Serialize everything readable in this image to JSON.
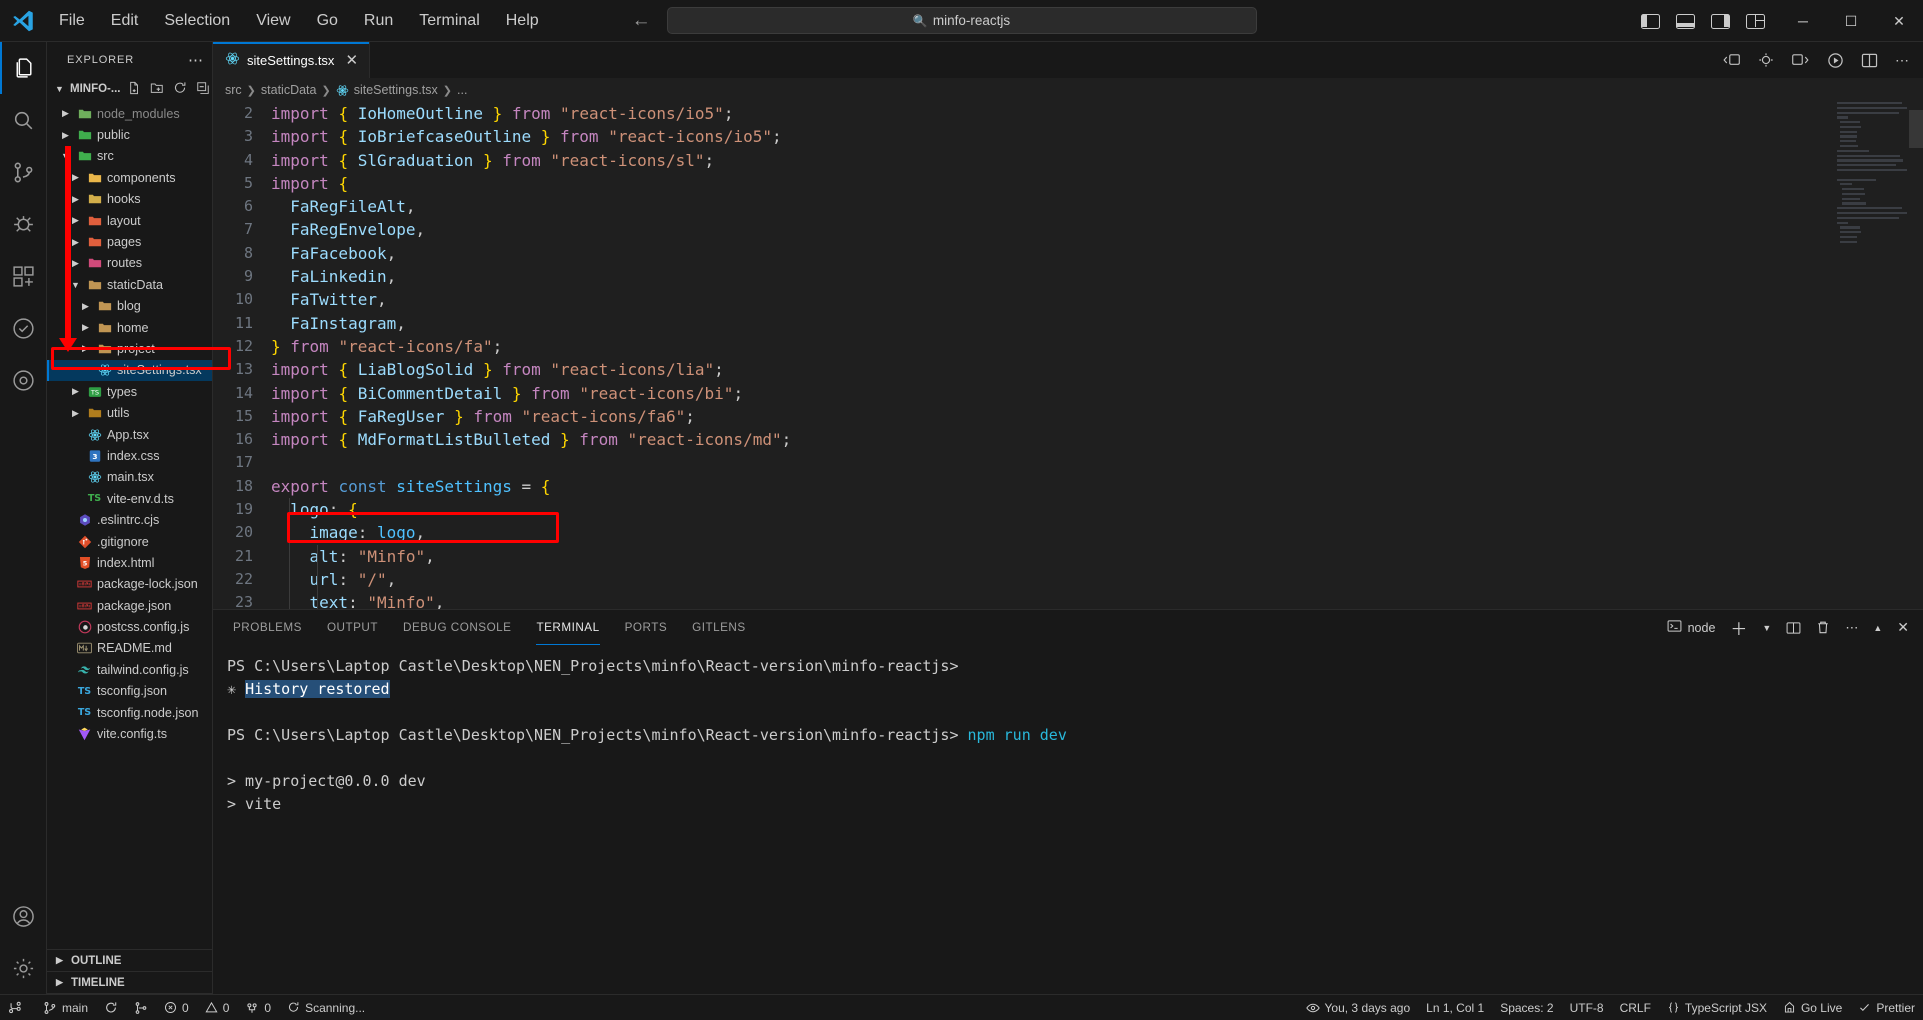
{
  "titlebar": {
    "logo_icon": "vscode-logo-icon",
    "menus": [
      "File",
      "Edit",
      "Selection",
      "View",
      "Go",
      "Run",
      "Terminal",
      "Help"
    ],
    "nav_back_icon": "arrow-left-icon",
    "nav_forward_icon": "arrow-right-icon",
    "search_value": "minfo-reactjs",
    "search_icon": "search-icon",
    "layout_icons": [
      "toggle-primary-sidebar-icon",
      "toggle-panel-icon",
      "toggle-secondary-sidebar-icon",
      "customize-layout-icon"
    ],
    "window_controls": {
      "minimize": "─",
      "maximize": "☐",
      "close": "✕"
    }
  },
  "activitybar": {
    "items": [
      {
        "name": "explorer",
        "icon": "files-icon",
        "active": true
      },
      {
        "name": "search",
        "icon": "search-icon",
        "active": false
      },
      {
        "name": "source-control",
        "icon": "source-control-icon",
        "active": false
      },
      {
        "name": "run-and-debug",
        "icon": "debug-icon",
        "active": false
      },
      {
        "name": "extensions",
        "icon": "extensions-icon",
        "active": false
      },
      {
        "name": "testing",
        "icon": "beaker-icon",
        "active": false
      },
      {
        "name": "gitlens",
        "icon": "gitlens-icon",
        "active": false
      }
    ],
    "bottom": [
      {
        "name": "accounts",
        "icon": "account-icon"
      },
      {
        "name": "settings",
        "icon": "gear-icon"
      }
    ]
  },
  "sidebar": {
    "header_title": "EXPLORER",
    "header_more_icon": "ellipsis-icon",
    "project_name": "MINFO-...",
    "project_actions": [
      "new-file-icon",
      "new-folder-icon",
      "refresh-icon",
      "collapse-all-icon"
    ],
    "tree": [
      {
        "label": "node_modules",
        "depth": 1,
        "type": "folder",
        "expanded": false,
        "icon": "folder-node-modules-icon",
        "dim": true
      },
      {
        "label": "public",
        "depth": 1,
        "type": "folder",
        "expanded": false,
        "icon": "folder-public-icon"
      },
      {
        "label": "src",
        "depth": 1,
        "type": "folder",
        "expanded": true,
        "icon": "folder-src-icon"
      },
      {
        "label": "components",
        "depth": 2,
        "type": "folder",
        "expanded": false,
        "icon": "folder-components-icon"
      },
      {
        "label": "hooks",
        "depth": 2,
        "type": "folder",
        "expanded": false,
        "icon": "folder-hooks-icon"
      },
      {
        "label": "layout",
        "depth": 2,
        "type": "folder",
        "expanded": false,
        "icon": "folder-layout-icon"
      },
      {
        "label": "pages",
        "depth": 2,
        "type": "folder",
        "expanded": false,
        "icon": "folder-pages-icon"
      },
      {
        "label": "routes",
        "depth": 2,
        "type": "folder",
        "expanded": false,
        "icon": "folder-routes-icon"
      },
      {
        "label": "staticData",
        "depth": 2,
        "type": "folder",
        "expanded": true,
        "icon": "folder-icon"
      },
      {
        "label": "blog",
        "depth": 3,
        "type": "folder",
        "expanded": false,
        "icon": "folder-icon"
      },
      {
        "label": "home",
        "depth": 3,
        "type": "folder",
        "expanded": false,
        "icon": "folder-icon"
      },
      {
        "label": "project",
        "depth": 3,
        "type": "folder",
        "expanded": false,
        "icon": "folder-icon"
      },
      {
        "label": "siteSettings.tsx",
        "depth": 3,
        "type": "file",
        "icon": "react-icon",
        "selected": true
      },
      {
        "label": "types",
        "depth": 2,
        "type": "folder",
        "expanded": false,
        "icon": "folder-types-icon"
      },
      {
        "label": "utils",
        "depth": 2,
        "type": "folder",
        "expanded": false,
        "icon": "folder-utils-icon"
      },
      {
        "label": "App.tsx",
        "depth": 2,
        "type": "file",
        "icon": "react-icon"
      },
      {
        "label": "index.css",
        "depth": 2,
        "type": "file",
        "icon": "css-icon"
      },
      {
        "label": "main.tsx",
        "depth": 2,
        "type": "file",
        "icon": "react-icon"
      },
      {
        "label": "vite-env.d.ts",
        "depth": 2,
        "type": "file",
        "icon": "typescript-def-icon"
      },
      {
        "label": ".eslintrc.cjs",
        "depth": 1,
        "type": "file",
        "icon": "eslint-icon"
      },
      {
        "label": ".gitignore",
        "depth": 1,
        "type": "file",
        "icon": "git-icon"
      },
      {
        "label": "index.html",
        "depth": 1,
        "type": "file",
        "icon": "html-icon"
      },
      {
        "label": "package-lock.json",
        "depth": 1,
        "type": "file",
        "icon": "npm-icon"
      },
      {
        "label": "package.json",
        "depth": 1,
        "type": "file",
        "icon": "npm-icon"
      },
      {
        "label": "postcss.config.js",
        "depth": 1,
        "type": "file",
        "icon": "postcss-icon"
      },
      {
        "label": "README.md",
        "depth": 1,
        "type": "file",
        "icon": "markdown-icon"
      },
      {
        "label": "tailwind.config.js",
        "depth": 1,
        "type": "file",
        "icon": "tailwind-icon"
      },
      {
        "label": "tsconfig.json",
        "depth": 1,
        "type": "file",
        "icon": "tsconfig-icon"
      },
      {
        "label": "tsconfig.node.json",
        "depth": 1,
        "type": "file",
        "icon": "tsconfig-icon"
      },
      {
        "label": "vite.config.ts",
        "depth": 1,
        "type": "file",
        "icon": "vite-icon"
      }
    ],
    "sections": [
      "OUTLINE",
      "TIMELINE"
    ]
  },
  "editor": {
    "tab": {
      "label": "siteSettings.tsx",
      "icon": "react-icon",
      "close_icon": "close-icon",
      "active": true
    },
    "tab_actions": [
      "split-comment-icon",
      "circle-icon",
      "arrow-icon",
      "run-icon",
      "split-editor-icon",
      "more-actions-icon"
    ],
    "breadcrumbs": [
      "src",
      "staticData",
      "siteSettings.tsx",
      "..."
    ],
    "breadcrumb_file_icon": "react-icon",
    "first_line_number": 2,
    "lines": [
      {
        "n": 2,
        "code": "import { IoHomeOutline } from \"react-icons/io5\";"
      },
      {
        "n": 3,
        "code": "import { IoBriefcaseOutline } from \"react-icons/io5\";"
      },
      {
        "n": 4,
        "code": "import { SlGraduation } from \"react-icons/sl\";"
      },
      {
        "n": 5,
        "code": "import {"
      },
      {
        "n": 6,
        "code": "  FaRegFileAlt,"
      },
      {
        "n": 7,
        "code": "  FaRegEnvelope,"
      },
      {
        "n": 8,
        "code": "  FaFacebook,"
      },
      {
        "n": 9,
        "code": "  FaLinkedin,"
      },
      {
        "n": 10,
        "code": "  FaTwitter,"
      },
      {
        "n": 11,
        "code": "  FaInstagram,"
      },
      {
        "n": 12,
        "code": "} from \"react-icons/fa\";"
      },
      {
        "n": 13,
        "code": "import { LiaBlogSolid } from \"react-icons/lia\";"
      },
      {
        "n": 14,
        "code": "import { BiCommentDetail } from \"react-icons/bi\";"
      },
      {
        "n": 15,
        "code": "import { FaRegUser } from \"react-icons/fa6\";"
      },
      {
        "n": 16,
        "code": "import { MdFormatListBulleted } from \"react-icons/md\";"
      },
      {
        "n": 17,
        "code": ""
      },
      {
        "n": 18,
        "code": "export const siteSettings = {"
      },
      {
        "n": 19,
        "code": "  logo: {"
      },
      {
        "n": 20,
        "code": "    image: logo,"
      },
      {
        "n": 21,
        "code": "    alt: \"Minfo\","
      },
      {
        "n": 22,
        "code": "    url: \"/\","
      },
      {
        "n": 23,
        "code": "    text: \"Minfo\","
      }
    ]
  },
  "panel": {
    "tabs": [
      "PROBLEMS",
      "OUTPUT",
      "DEBUG CONSOLE",
      "TERMINAL",
      "PORTS",
      "GITLENS"
    ],
    "active_tab": "TERMINAL",
    "terminal_chip": {
      "icon": "terminal-icon",
      "label": "node"
    },
    "actions": [
      "new-terminal-icon",
      "chevron-down-icon",
      "split-terminal-icon",
      "kill-terminal-icon",
      "more-actions-icon",
      "chevron-up-icon",
      "close-icon"
    ],
    "terminal_lines": [
      {
        "text": "PS C:\\Users\\Laptop Castle\\Desktop\\NEN_Projects\\minfo\\React-version\\minfo-reactjs>",
        "type": "prompt"
      },
      {
        "text": "History restored",
        "type": "highlight",
        "prefix": "✳"
      },
      {
        "text": "",
        "type": "blank"
      },
      {
        "text": "PS C:\\Users\\Laptop Castle\\Desktop\\NEN_Projects\\minfo\\React-version\\minfo-reactjs> ",
        "command": "npm run dev",
        "type": "prompt-cmd"
      },
      {
        "text": "",
        "type": "blank"
      },
      {
        "text": "> my-project@0.0.0 dev",
        "type": "out"
      },
      {
        "text": "> vite",
        "type": "out"
      },
      {
        "text": "",
        "type": "blank"
      }
    ]
  },
  "statusbar": {
    "left": [
      {
        "icon": "remote-icon",
        "label": "",
        "name": "remote-indicator"
      },
      {
        "icon": "branch-icon",
        "label": "main",
        "name": "git-branch"
      },
      {
        "icon": "sync-icon",
        "label": "",
        "name": "sync-changes"
      },
      {
        "icon": "git-changes-icon",
        "label": "",
        "name": "git-changes"
      },
      {
        "icon": "error-icon",
        "label": "0",
        "name": "errors"
      },
      {
        "icon": "warning-icon",
        "label": "0",
        "name": "warnings"
      },
      {
        "icon": "ports-icon",
        "label": "0",
        "name": "forwarded-ports"
      },
      {
        "icon": "sync-spin-icon",
        "label": "Scanning...",
        "name": "scanning"
      }
    ],
    "right": [
      {
        "icon": "eye-icon",
        "label": "You, 3 days ago",
        "name": "gitlens-blame"
      },
      {
        "icon": "",
        "label": "Ln 1, Col 1",
        "name": "cursor-position"
      },
      {
        "icon": "",
        "label": "Spaces: 2",
        "name": "indentation"
      },
      {
        "icon": "",
        "label": "UTF-8",
        "name": "encoding"
      },
      {
        "icon": "",
        "label": "CRLF",
        "name": "eol"
      },
      {
        "icon": "braces-icon",
        "label": "TypeScript JSX",
        "name": "language-mode"
      },
      {
        "icon": "bell-icon",
        "label": "Go Live",
        "name": "go-live"
      },
      {
        "icon": "check-icon",
        "label": "Prettier",
        "name": "prettier-status"
      }
    ]
  },
  "annotations": {
    "highlight_box_code": {
      "target": "image: logo,"
    },
    "highlight_box_file": {
      "target": "siteSettings.tsx"
    },
    "arrow": {
      "color": "#ff0000",
      "points_to": "siteSettings.tsx"
    }
  },
  "colors": {
    "accent": "#0078d4",
    "annotation": "#ff0000",
    "selection": "#04395e",
    "bg": "#1f1f1f",
    "chrome": "#181818"
  }
}
